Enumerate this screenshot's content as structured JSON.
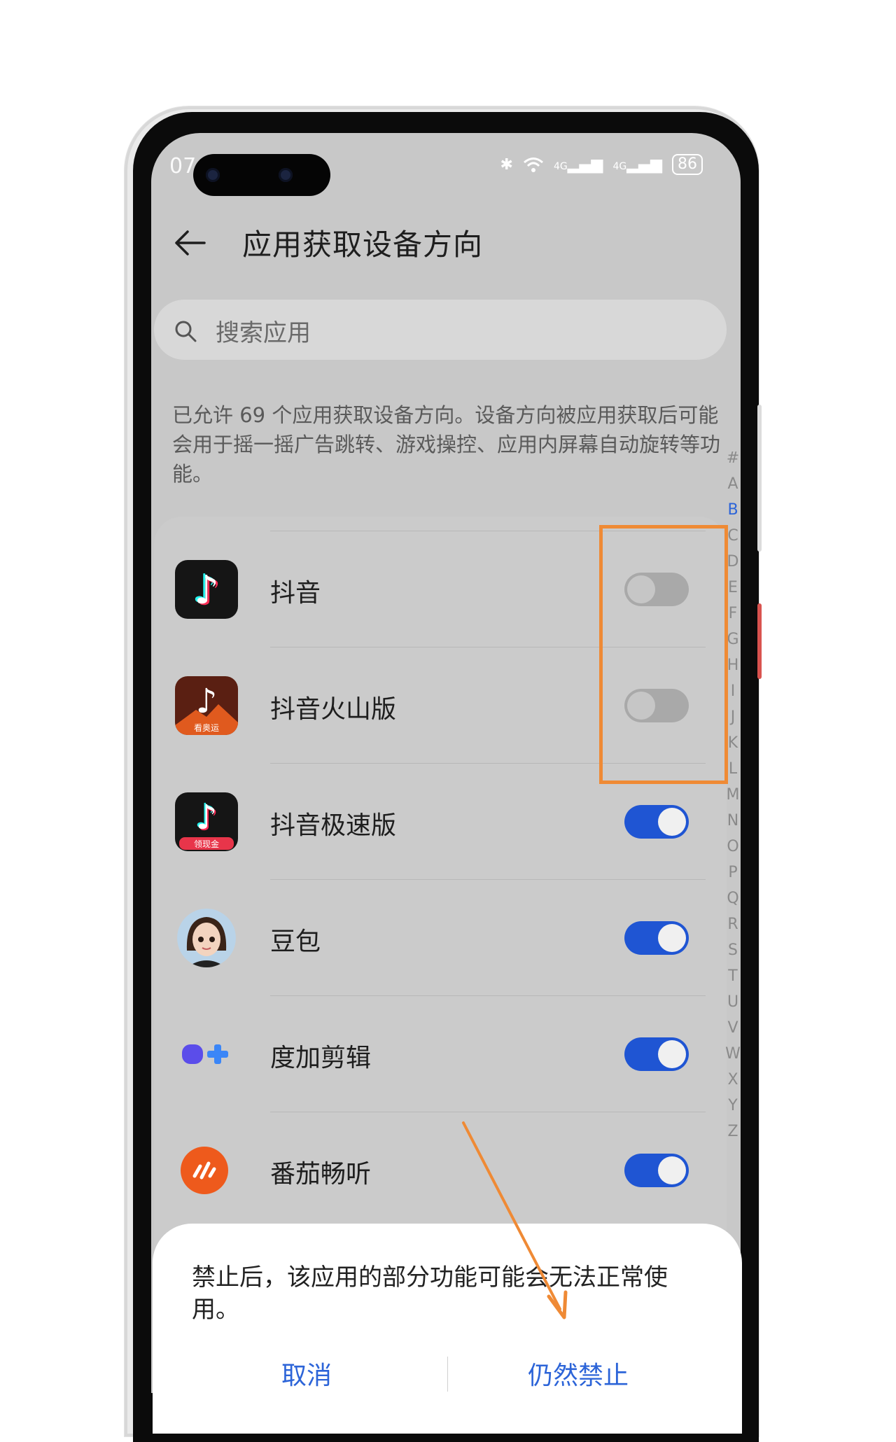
{
  "status_bar": {
    "time": "07",
    "network_1": "4G",
    "network_2": "4G",
    "battery": "86"
  },
  "header": {
    "title": "应用获取设备方向"
  },
  "search": {
    "placeholder": "搜索应用"
  },
  "description": "已允许 69 个应用获取设备方向。设备方向被应用获取后可能会用于摇一摇广告跳转、游戏操控、应用内屏幕自动旋转等功能。",
  "apps": [
    {
      "name": "抖音",
      "enabled": false,
      "icon": "douyin-icon",
      "badge": ""
    },
    {
      "name": "抖音火山版",
      "enabled": false,
      "icon": "douyin-huoshan-icon",
      "badge": "看奥运"
    },
    {
      "name": "抖音极速版",
      "enabled": true,
      "icon": "douyin-jisu-icon",
      "badge": "领现金"
    },
    {
      "name": "豆包",
      "enabled": true,
      "icon": "doubao-avatar-icon",
      "badge": ""
    },
    {
      "name": "度加剪辑",
      "enabled": true,
      "icon": "dujia-icon",
      "badge": ""
    },
    {
      "name": "番茄畅听",
      "enabled": true,
      "icon": "fanqie-icon",
      "badge": ""
    }
  ],
  "alphabet_index": [
    "#",
    "A",
    "B",
    "C",
    "D",
    "E",
    "F",
    "G",
    "H",
    "I",
    "J",
    "K",
    "L",
    "M",
    "N",
    "O",
    "P",
    "Q",
    "R",
    "S",
    "T",
    "U",
    "V",
    "W",
    "X",
    "Y",
    "Z"
  ],
  "alphabet_active": "B",
  "dialog": {
    "message": "禁止后，该应用的部分功能可能会无法正常使用。",
    "cancel_label": "取消",
    "confirm_label": "仍然禁止"
  },
  "colors": {
    "accent": "#1f55d3",
    "annotation": "#ef8a35",
    "screen_dim": "#c8c8c8"
  }
}
